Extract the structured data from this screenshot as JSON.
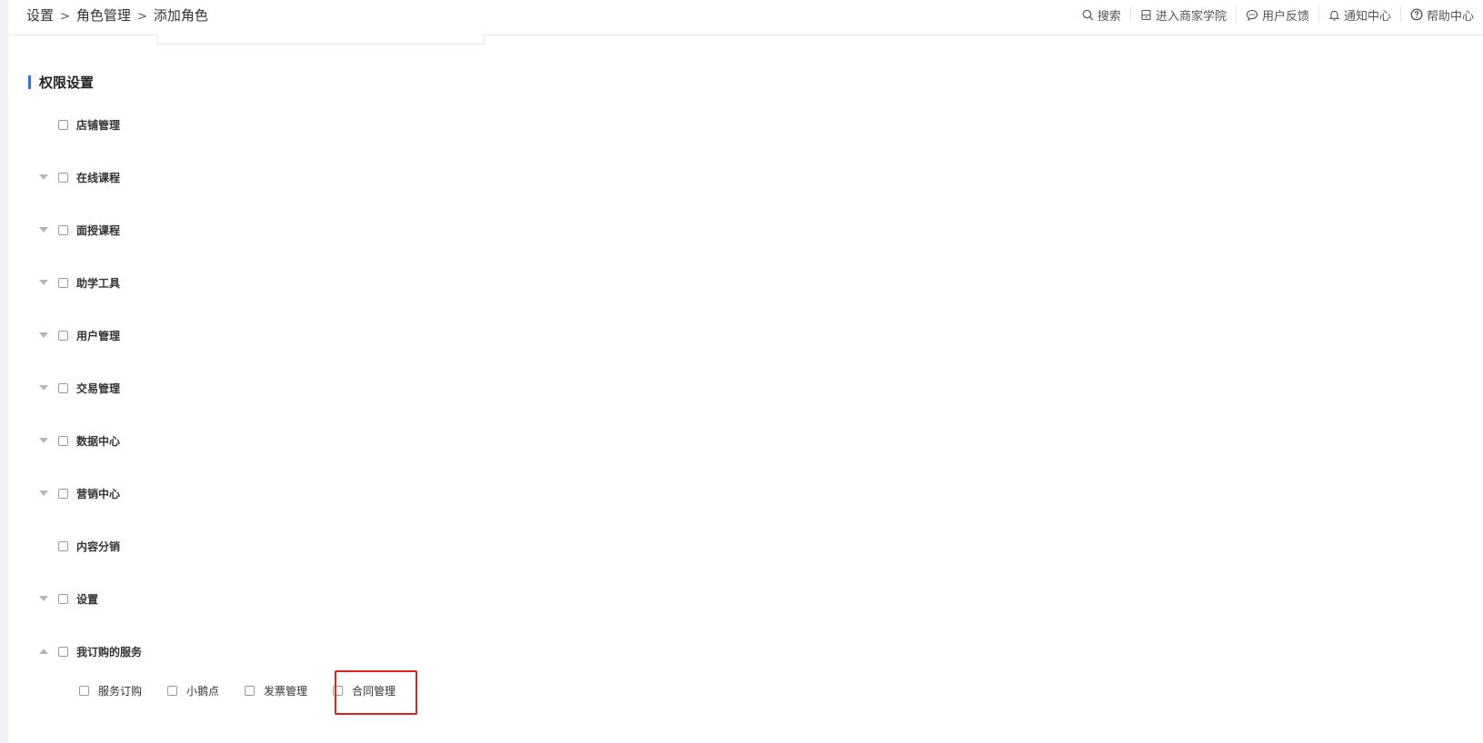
{
  "breadcrumb": {
    "items": [
      "设置",
      "角色管理",
      "添加角色"
    ],
    "separator": ">"
  },
  "topnav": {
    "items": [
      {
        "icon": "search-icon",
        "label": "搜索"
      },
      {
        "icon": "book-icon",
        "label": "进入商家学院"
      },
      {
        "icon": "chat-icon",
        "label": "用户反馈"
      },
      {
        "icon": "bell-icon",
        "label": "通知中心"
      },
      {
        "icon": "help-icon",
        "label": "帮助中心"
      }
    ]
  },
  "section": {
    "title": "权限设置",
    "accent_color": "#2f6ff5"
  },
  "permissions": [
    {
      "label": "店铺管理",
      "expandable": false,
      "checked": false
    },
    {
      "label": "在线课程",
      "expandable": true,
      "expanded": false,
      "checked": false
    },
    {
      "label": "面授课程",
      "expandable": true,
      "expanded": false,
      "checked": false
    },
    {
      "label": "助学工具",
      "expandable": true,
      "expanded": false,
      "checked": false
    },
    {
      "label": "用户管理",
      "expandable": true,
      "expanded": false,
      "checked": false
    },
    {
      "label": "交易管理",
      "expandable": true,
      "expanded": false,
      "checked": false
    },
    {
      "label": "数据中心",
      "expandable": true,
      "expanded": false,
      "checked": false
    },
    {
      "label": "营销中心",
      "expandable": true,
      "expanded": false,
      "checked": false
    },
    {
      "label": "内容分销",
      "expandable": false,
      "checked": false
    },
    {
      "label": "设置",
      "expandable": true,
      "expanded": false,
      "checked": false
    },
    {
      "label": "我订购的服务",
      "expandable": true,
      "expanded": true,
      "checked": false
    }
  ],
  "subpermissions": [
    {
      "label": "服务订购",
      "checked": false
    },
    {
      "label": "小鹅点",
      "checked": false
    },
    {
      "label": "发票管理",
      "checked": false
    },
    {
      "label": "合同管理",
      "checked": false,
      "highlighted": true
    }
  ],
  "highlight_color": "#e0201b"
}
